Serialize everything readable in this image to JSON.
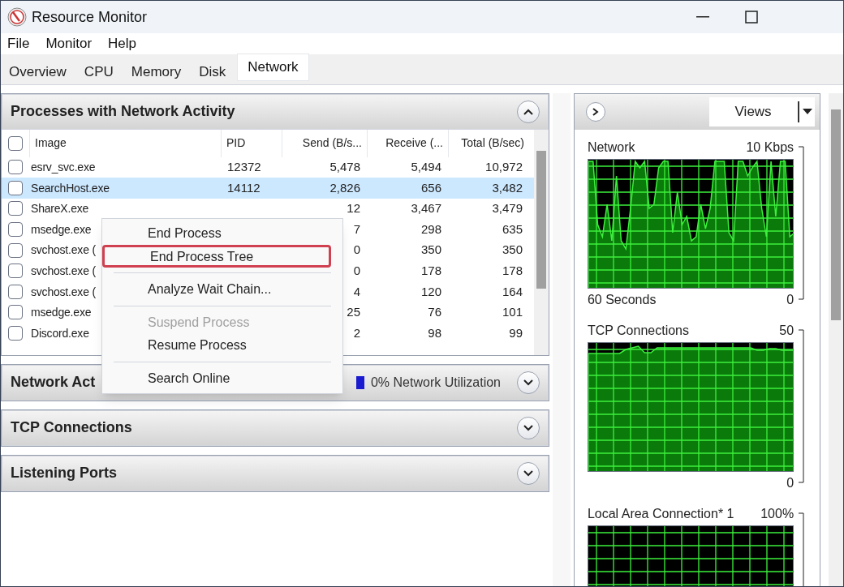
{
  "window": {
    "title": "Resource Monitor"
  },
  "menu_bar": [
    "File",
    "Monitor",
    "Help"
  ],
  "tabs": [
    {
      "label": "Overview",
      "selected": false
    },
    {
      "label": "CPU",
      "selected": false
    },
    {
      "label": "Memory",
      "selected": false
    },
    {
      "label": "Disk",
      "selected": false
    },
    {
      "label": "Network",
      "selected": true
    }
  ],
  "processes": {
    "title": "Processes with Network Activity",
    "expanded": true,
    "all_checked": false,
    "columns": [
      "Image",
      "PID",
      "Send (B/s...",
      "Receive (...",
      "Total (B/sec)"
    ],
    "rows": [
      {
        "image": "esrv_svc.exe",
        "pid": "12372",
        "send": "5,478",
        "receive": "5,494",
        "total": "10,972",
        "selected": false,
        "checked": false
      },
      {
        "image": "SearchHost.exe",
        "pid": "14112",
        "send": "2,826",
        "receive": "656",
        "total": "3,482",
        "selected": true,
        "checked": false
      },
      {
        "image": "ShareX.exe",
        "send": "12",
        "receive": "3,467",
        "total": "3,479",
        "selected": false,
        "checked": false
      },
      {
        "image": "msedge.exe",
        "send": "7",
        "receive": "298",
        "total": "635",
        "selected": false,
        "checked": false
      },
      {
        "image": "svchost.exe (",
        "send": "0",
        "receive": "350",
        "total": "350",
        "selected": false,
        "checked": false
      },
      {
        "image": "svchost.exe (",
        "send": "0",
        "receive": "178",
        "total": "178",
        "selected": false,
        "checked": false
      },
      {
        "image": "svchost.exe (",
        "send": "4",
        "receive": "120",
        "total": "164",
        "selected": false,
        "checked": false
      },
      {
        "image": "msedge.exe",
        "send": "25",
        "receive": "76",
        "total": "101",
        "selected": false,
        "checked": false
      },
      {
        "image": "Discord.exe",
        "send": "2",
        "receive": "98",
        "total": "99",
        "selected": false,
        "checked": false
      }
    ]
  },
  "sections": [
    {
      "title": "Network Act",
      "utilization": "0% Network Utilization",
      "expanded": false
    },
    {
      "title": "TCP Connections",
      "expanded": false
    },
    {
      "title": "Listening Ports",
      "expanded": false
    }
  ],
  "context_menu": [
    {
      "kind": "item",
      "label": "End Process",
      "disabled": false,
      "highlighted": false
    },
    {
      "kind": "item",
      "label": "End Process Tree",
      "disabled": false,
      "highlighted": true
    },
    {
      "kind": "separator"
    },
    {
      "kind": "item",
      "label": "Analyze Wait Chain...",
      "disabled": false,
      "highlighted": false
    },
    {
      "kind": "separator"
    },
    {
      "kind": "item",
      "label": "Suspend Process",
      "disabled": true,
      "highlighted": false
    },
    {
      "kind": "item",
      "label": "Resume Process",
      "disabled": false,
      "highlighted": false
    },
    {
      "kind": "separator"
    },
    {
      "kind": "item",
      "label": "Search Online",
      "disabled": false,
      "highlighted": false
    }
  ],
  "side_panel": {
    "views_button": "Views",
    "graphs": [
      {
        "kind": "spiky",
        "title": "Network",
        "max": "10 Kbps",
        "footer": "60 Seconds",
        "min": "0"
      },
      {
        "kind": "flat",
        "title": "TCP Connections",
        "max": "50",
        "min": "0"
      },
      {
        "kind": "empty",
        "title": "Local Area Connection* 1",
        "max": "100%"
      }
    ]
  }
}
